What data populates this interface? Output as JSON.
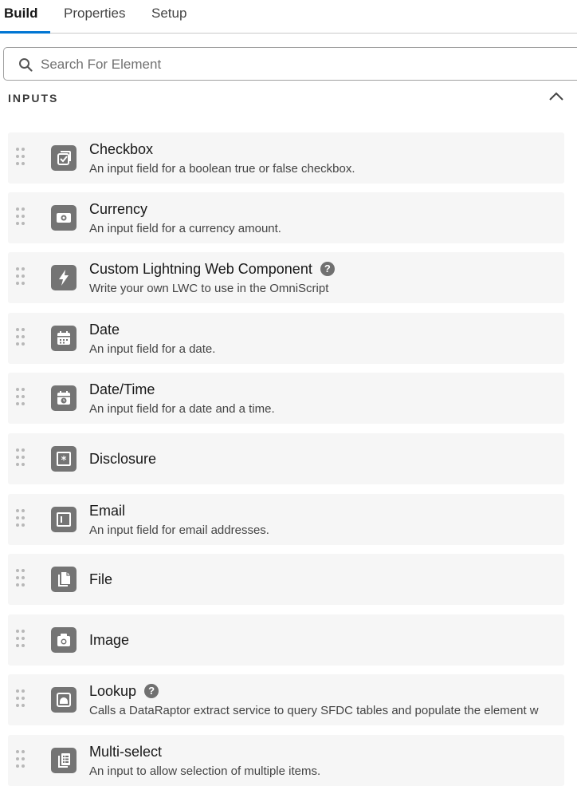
{
  "tabs": [
    {
      "label": "Build",
      "active": true
    },
    {
      "label": "Properties",
      "active": false
    },
    {
      "label": "Setup",
      "active": false
    }
  ],
  "search": {
    "placeholder": "Search For Element",
    "value": ""
  },
  "section": {
    "title": "INPUTS",
    "expanded": true
  },
  "items": [
    {
      "title": "Checkbox",
      "desc": "An input field for a boolean true or false checkbox.",
      "icon": "checkbox-icon"
    },
    {
      "title": "Currency",
      "desc": "An input field for a currency amount.",
      "icon": "currency-icon"
    },
    {
      "title": "Custom Lightning Web Component",
      "desc": "Write your own LWC to use in the OmniScript",
      "icon": "lightning-icon",
      "help": "?"
    },
    {
      "title": "Date",
      "desc": "An input field for a date.",
      "icon": "calendar-icon"
    },
    {
      "title": "Date/Time",
      "desc": "An input field for a date and a time.",
      "icon": "calendar-clock-icon"
    },
    {
      "title": "Disclosure",
      "desc": "",
      "icon": "disclosure-icon"
    },
    {
      "title": "Email",
      "desc": "An input field for email addresses.",
      "icon": "email-field-icon"
    },
    {
      "title": "File",
      "desc": "",
      "icon": "file-icon"
    },
    {
      "title": "Image",
      "desc": "",
      "icon": "camera-icon"
    },
    {
      "title": "Lookup",
      "desc": "Calls a DataRaptor extract service to query SFDC tables and populate the element w",
      "icon": "lookup-icon",
      "help": "?"
    },
    {
      "title": "Multi-select",
      "desc": "An input to allow selection of multiple items.",
      "icon": "multiselect-icon"
    }
  ],
  "colors": {
    "accent": "#0176d3",
    "icon_bg": "#747474",
    "item_bg": "#f6f6f6"
  }
}
